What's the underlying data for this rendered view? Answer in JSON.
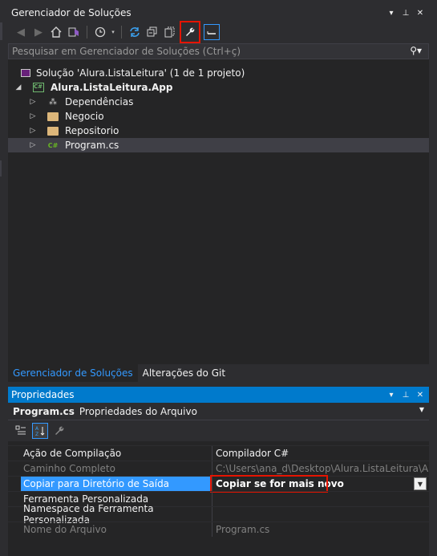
{
  "solution_explorer": {
    "title": "Gerenciador de Soluções",
    "title_controls": [
      "▾",
      "⊥",
      "✕"
    ],
    "search_placeholder": "Pesquisar em Gerenciador de Soluções (Ctrl+ç)",
    "search_icon": "search-icon",
    "toolbar": {
      "icons": [
        "back-icon",
        "forward-icon",
        "home-icon",
        "vs-switch-views-icon",
        "history-icon",
        "sync-icon",
        "collapse-all-icon",
        "show-all-files-icon",
        "properties-wrench-icon",
        "preview-icon"
      ]
    },
    "tree": {
      "solution": "Solução 'Alura.ListaLeitura' (1 de 1 projeto)",
      "project": "Alura.ListaLeitura.App",
      "project_badge": "C#",
      "items": [
        {
          "label": "Dependências",
          "icon": "dependencies-icon"
        },
        {
          "label": "Negocio",
          "icon": "folder-icon"
        },
        {
          "label": "Repositorio",
          "icon": "folder-icon"
        },
        {
          "label": "Program.cs",
          "icon": "csharp-file-icon",
          "badge": "C#"
        }
      ]
    },
    "tabs": [
      "Gerenciador de Soluções",
      "Alterações do Git"
    ]
  },
  "properties": {
    "title": "Propriedades",
    "title_controls": [
      "▾",
      "⊥",
      "✕"
    ],
    "object_name": "Program.cs",
    "object_type": "Propriedades do Arquivo",
    "rows": [
      {
        "name": "Ação de Compilação",
        "value": "Compilador C#"
      },
      {
        "name": "Caminho Completo",
        "value": "C:\\Users\\ana_d\\Desktop\\Alura.ListaLeitura\\Alura.Li"
      },
      {
        "name": "Copiar para Diretório de Saída",
        "value": "Copiar se for mais novo"
      },
      {
        "name": "Ferramenta Personalizada",
        "value": ""
      },
      {
        "name": "Namespace da Ferramenta Personalizada",
        "value": ""
      },
      {
        "name": "Nome do Arquivo",
        "value": "Program.cs"
      }
    ]
  },
  "colors": {
    "accent": "#007acc",
    "selection": "#3399ff",
    "highlight_box": "#e51400",
    "background": "#252526"
  }
}
